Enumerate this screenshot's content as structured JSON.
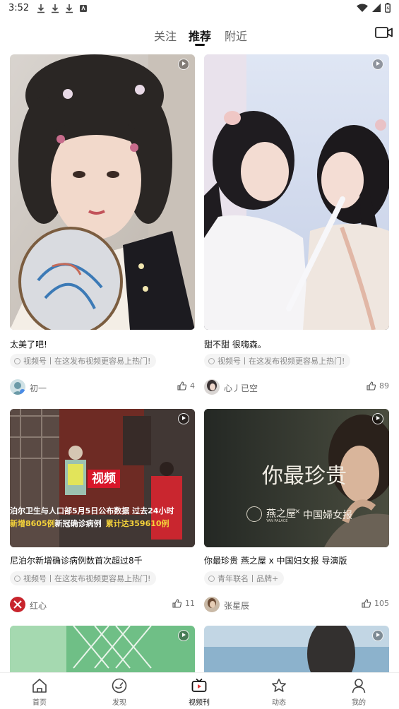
{
  "status_bar": {
    "time": "3:52"
  },
  "top_tabs": [
    {
      "label": "关注"
    },
    {
      "label": "推荐"
    },
    {
      "label": "附近"
    }
  ],
  "cards": [
    {
      "title": "太美了吧!",
      "tag": "视频号丨在这发布视频更容易上热门!",
      "author": "初一",
      "likes": "4"
    },
    {
      "title": "甜不甜 很嗨森。",
      "tag": "视频号丨在这发布视频更容易上热门!",
      "author": "心丿已空",
      "likes": "89"
    },
    {
      "title": "尼泊尔新增确诊病例数首次超过8千",
      "tag": "视频号丨在这发布视频更容易上热门!",
      "author": "红心",
      "likes": "11",
      "overlay": {
        "logo": "视频",
        "line1": "泊尔卫生与人口部5月5日公布数据 过去24小时",
        "line2a": "新增8605例",
        "line2b": "新冠确诊病例",
        "line2c": "累计达359610例"
      }
    },
    {
      "title": "你最珍贵 燕之屋 x 中国妇女报 导演版",
      "tag": "青年联名丨品牌+",
      "author": "张星辰",
      "likes": "105",
      "overlay": {
        "headline": "你最珍贵",
        "brand1": "燕之屋",
        "brand1_sub": "YAN PALACE",
        "x": "×",
        "brand2": "中国婦女报"
      }
    }
  ],
  "bottom_nav": [
    {
      "label": "首页"
    },
    {
      "label": "发现"
    },
    {
      "label": "视频刊"
    },
    {
      "label": "动态"
    },
    {
      "label": "我的"
    }
  ],
  "colors": {
    "accent": "#e23b3b",
    "text": "#111111",
    "muted": "#888888"
  }
}
